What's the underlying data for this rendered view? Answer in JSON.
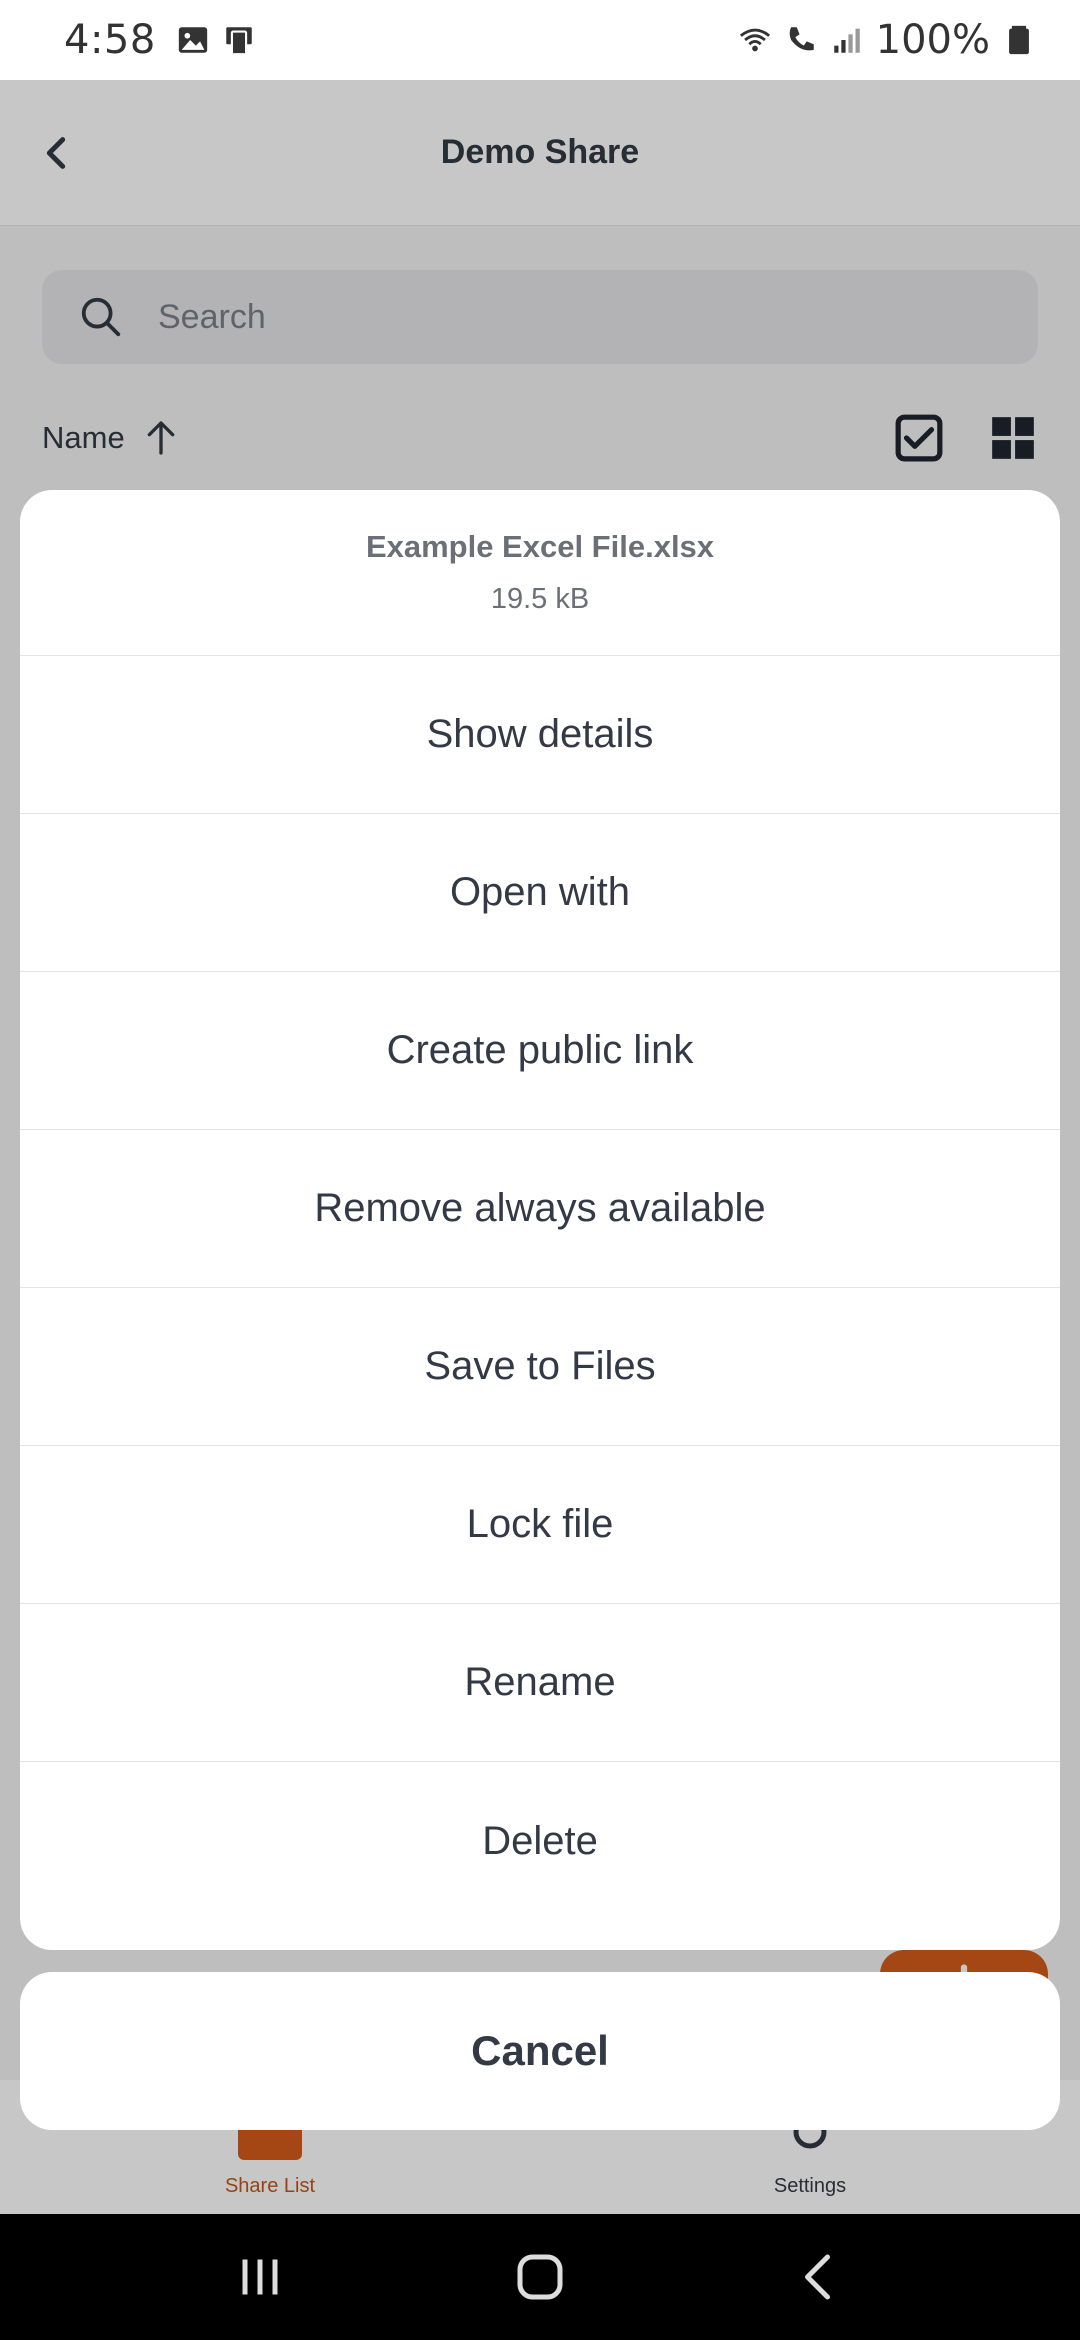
{
  "status_bar": {
    "time": "4:58",
    "battery": "100%",
    "icons": [
      "image-icon",
      "device-icon",
      "wifi-calling-icon",
      "phone-call-icon",
      "signal-icon",
      "battery-icon"
    ]
  },
  "header": {
    "title": "Demo Share",
    "back_icon": "back-chevron-icon"
  },
  "search": {
    "placeholder": "Search"
  },
  "sort": {
    "label": "Name",
    "direction_icon": "arrow-up-icon",
    "select_icon": "checkbox-icon",
    "view_icon": "grid-view-icon"
  },
  "sheet": {
    "file_name": "Example Excel File.xlsx",
    "file_size": "19.5 kB",
    "actions": [
      {
        "label": "Show details"
      },
      {
        "label": "Open with"
      },
      {
        "label": "Create public link"
      },
      {
        "label": "Remove always available"
      },
      {
        "label": "Save to Files"
      },
      {
        "label": "Lock file"
      },
      {
        "label": "Rename"
      },
      {
        "label": "Delete"
      }
    ],
    "cancel_label": "Cancel"
  },
  "tabbar": {
    "tabs": [
      {
        "label": "Share List",
        "active": true
      },
      {
        "label": "Settings",
        "active": false
      }
    ],
    "accent_color": "#c1561a"
  },
  "fab": {
    "icon": "plus-icon",
    "color": "#d35c1c"
  }
}
